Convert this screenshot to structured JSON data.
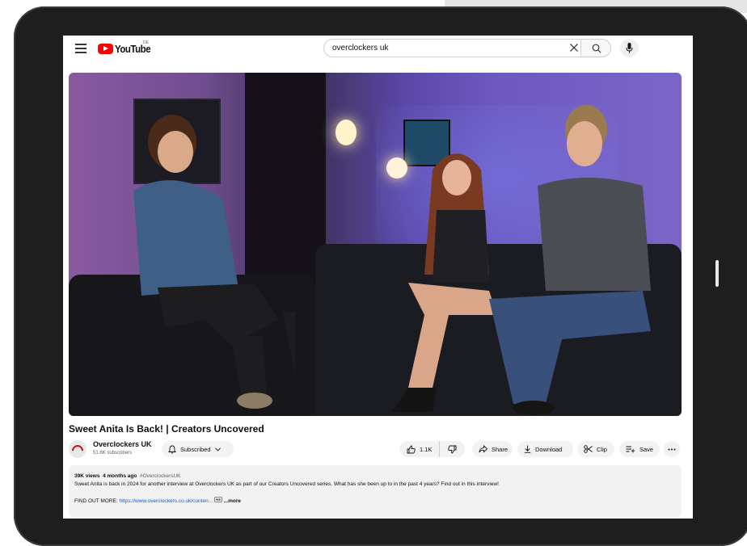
{
  "header": {
    "logo_text": "YouTube",
    "region_code": "DE",
    "search_value": "overclockers uk"
  },
  "video": {
    "title": "Sweet Anita Is Back! | Creators Uncovered"
  },
  "channel": {
    "name": "Overclockers UK",
    "subscribers": "51.6K subscribers",
    "subscribe_label": "Subscribed"
  },
  "actions": {
    "like_count": "1.1K",
    "share_label": "Share",
    "download_label": "Download",
    "clip_label": "Clip",
    "save_label": "Save"
  },
  "description": {
    "views": "39K views",
    "age": "4 months ago",
    "hashtag": "#OverclockersUK",
    "text": "Sweet Anita is back in 2024 for another interview at Overclockers UK as part of our Creators Uncovered series. What has she been up to in the past 4 years? Find out in this interview!",
    "find_out_label": "FIND OUT MORE:",
    "link": "https://www.overclockers.co.uk/conten...",
    "more_label": "...more"
  },
  "colors": {
    "brand": "#ff0000",
    "link": "#065fd4",
    "pill_bg": "#f2f2f2"
  }
}
